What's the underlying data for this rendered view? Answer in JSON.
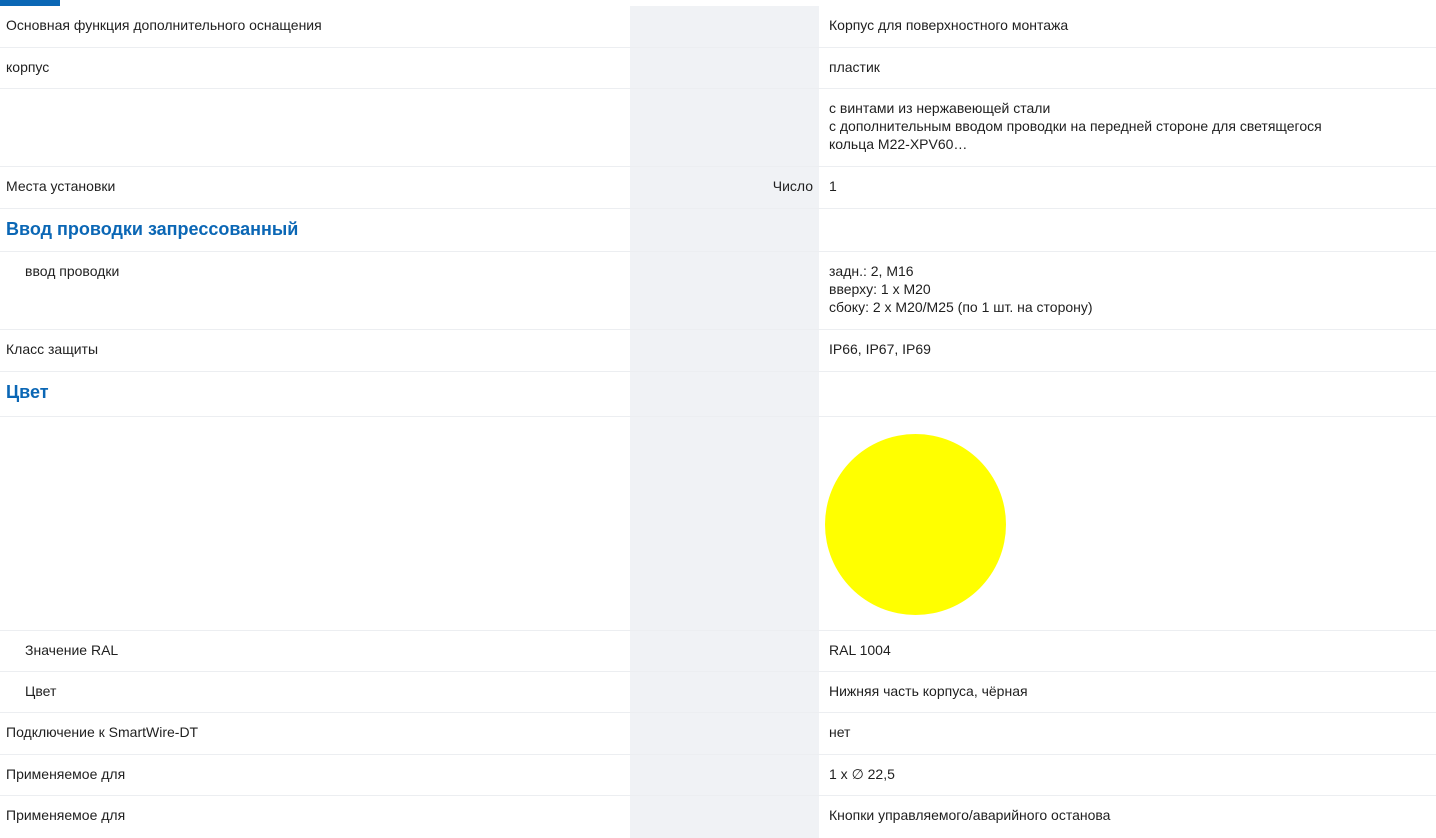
{
  "rows": {
    "r0": {
      "label": "Основная функция дополнительного оснащения",
      "value": "Корпус для поверхностного монтажа"
    },
    "r1": {
      "label": "корпус",
      "value": "пластик"
    },
    "r2": {
      "lines": [
        "с винтами из нержавеющей стали",
        "с дополнительным вводом проводки на передней стороне для светящегося",
        "кольца M22-XPV60…"
      ]
    },
    "r3": {
      "label": "Места установки",
      "unit": "Число",
      "value": "1"
    },
    "s1": {
      "title": "Ввод проводки запрессованный"
    },
    "r4": {
      "label": "ввод проводки",
      "lines": [
        "задн.: 2, M16",
        "вверху: 1 x M20",
        "сбоку: 2 x M20/M25 (по 1 шт. на сторону)"
      ]
    },
    "r5": {
      "label": "Класс защиты",
      "value": "IP66, IP67, IP69"
    },
    "s2": {
      "title": "Цвет"
    },
    "swatch": {
      "color": "#ffff00"
    },
    "r6": {
      "label": "Значение RAL",
      "value": "RAL 1004"
    },
    "r7": {
      "label": "Цвет",
      "value": "Нижняя часть корпуса, чёрная"
    },
    "r8": {
      "label": "Подключение к SmartWire-DT",
      "value": "нет"
    },
    "r9": {
      "label": "Применяемое для",
      "value": "1 x ∅ 22,5"
    },
    "r10": {
      "label": "Применяемое для",
      "value": "Кнопки управляемого/аварийного останова"
    }
  },
  "colors": {
    "accent": "#0b67b5",
    "middle_column_bg": "#f0f2f5"
  }
}
